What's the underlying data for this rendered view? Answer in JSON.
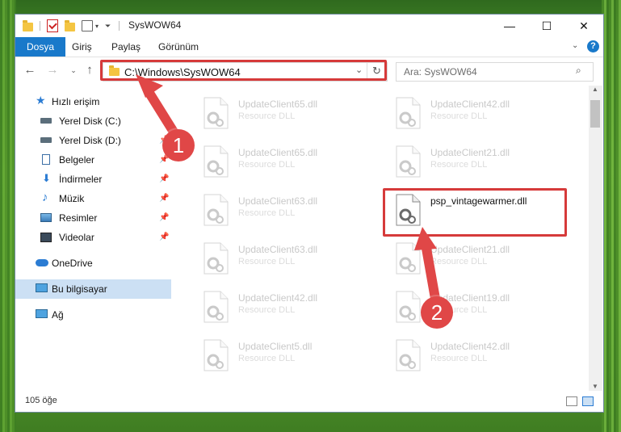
{
  "window": {
    "title": "SysWOW64",
    "minimize_icon": "minimize-icon",
    "maximize_icon": "maximize-icon",
    "close_icon": "close-icon"
  },
  "ribbon": {
    "tabs": [
      {
        "label": "Dosya",
        "active": true
      },
      {
        "label": "Giriş"
      },
      {
        "label": "Paylaş"
      },
      {
        "label": "Görünüm"
      }
    ]
  },
  "address": {
    "path": "C:\\Windows\\SysWOW64"
  },
  "search": {
    "placeholder": "Ara: SysWOW64"
  },
  "navpane": {
    "items": [
      {
        "label": "Hızlı erişim",
        "icon": "star-icon"
      },
      {
        "label": "Yerel Disk (C:)",
        "icon": "drive-icon",
        "pinned": true
      },
      {
        "label": "Yerel Disk (D:)",
        "icon": "drive-icon",
        "pinned": true
      },
      {
        "label": "Belgeler",
        "icon": "documents-icon",
        "pinned": true
      },
      {
        "label": "İndirmeler",
        "icon": "download-icon",
        "pinned": true
      },
      {
        "label": "Müzik",
        "icon": "music-icon",
        "pinned": true
      },
      {
        "label": "Resimler",
        "icon": "pictures-icon",
        "pinned": true
      },
      {
        "label": "Videolar",
        "icon": "video-icon",
        "pinned": true
      },
      {
        "label": "OneDrive",
        "icon": "cloud-icon"
      },
      {
        "label": "Bu bilgisayar",
        "icon": "computer-icon",
        "selected": true
      },
      {
        "label": "Ağ",
        "icon": "network-icon"
      }
    ]
  },
  "files": [
    {
      "name": "UpdateClient65.dll",
      "type": "Resource DLL"
    },
    {
      "name": "UpdateClient42.dll",
      "type": "Resource DLL"
    },
    {
      "name": "UpdateClient65.dll",
      "type": "Resource DLL"
    },
    {
      "name": "UpdateClient21.dll",
      "type": "Resource DLL"
    },
    {
      "name": "UpdateClient63.dll",
      "type": "Resource DLL"
    },
    {
      "name": "psp_vintagewarmer.dll",
      "type": ""
    },
    {
      "name": "UpdateClient63.dll",
      "type": "Resource DLL"
    },
    {
      "name": "UpdateClient21.dll",
      "type": "Resource DLL"
    },
    {
      "name": "UpdateClient42.dll",
      "type": "Resource DLL"
    },
    {
      "name": "UpdateClient19.dll",
      "type": "Resource DLL"
    },
    {
      "name": "UpdateClient5.dll",
      "type": "Resource DLL"
    },
    {
      "name": "UpdateClient42.dll",
      "type": "Resource DLL"
    }
  ],
  "status": {
    "count": "105 öğe"
  },
  "annotations": {
    "step1": "1",
    "step2": "2",
    "color": "#d63a3a"
  }
}
